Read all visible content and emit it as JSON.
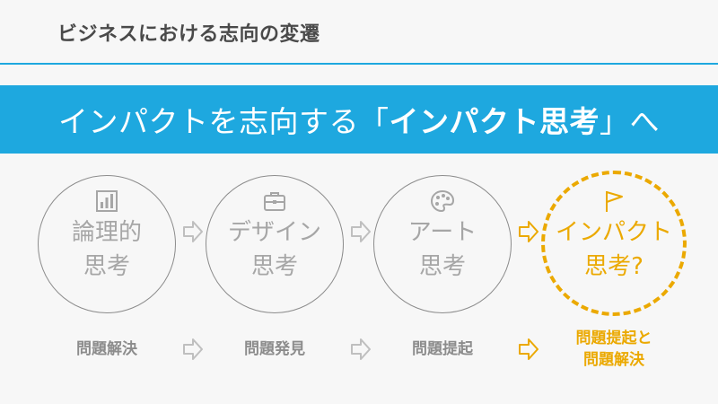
{
  "header": {
    "title": "ビジネスにおける志向の変遷"
  },
  "banner": {
    "text_before": "インパクトを志向する「",
    "text_bold": "インパクト思考",
    "text_after": "」へ"
  },
  "steps": [
    {
      "line1": "論理的",
      "line2": "思考",
      "icon": "bar-chart-icon",
      "label_line1": "問題解決",
      "label_line2": ""
    },
    {
      "line1": "デザイン",
      "line2": "思考",
      "icon": "toolbox-icon",
      "label_line1": "問題発見",
      "label_line2": ""
    },
    {
      "line1": "アート",
      "line2": "思考",
      "icon": "palette-icon",
      "label_line1": "問題提起",
      "label_line2": ""
    },
    {
      "line1": "インパクト",
      "line2": "思考?",
      "icon": "flag-icon",
      "label_line1": "問題提起と",
      "label_line2": "問題解決"
    }
  ],
  "colors": {
    "accent_blue": "#1ea8df",
    "highlight_gold": "#eba900",
    "muted_gray": "#a6a6a6"
  }
}
